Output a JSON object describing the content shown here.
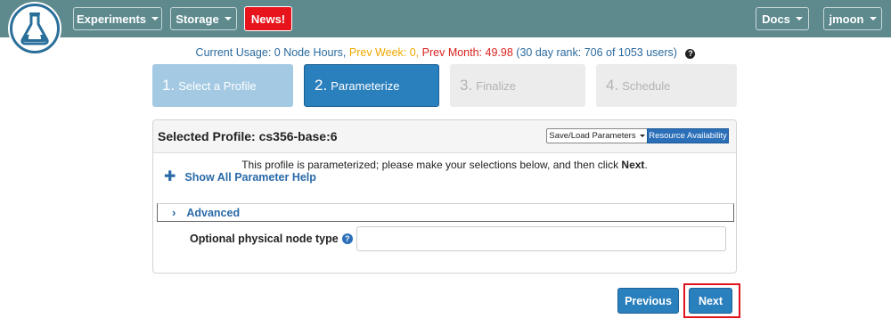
{
  "navbar": {
    "logo_icon": "flask-cloud-icon",
    "experiments_label": "Experiments",
    "storage_label": "Storage",
    "news_label": "News!",
    "docs_label": "Docs",
    "user_label": "jmoon"
  },
  "usage": {
    "current": "Current Usage: 0 Node Hours,",
    "prev_week": "Prev Week: 0,",
    "prev_month": "Prev Month: 49.98",
    "rank": "(30 day rank: 706 of 1053 users)",
    "help_icon": "question-circle-icon"
  },
  "steps": [
    {
      "num": "1.",
      "label": "Select a Profile",
      "state": "completed"
    },
    {
      "num": "2.",
      "label": "Parameterize",
      "state": "active"
    },
    {
      "num": "3.",
      "label": "Finalize",
      "state": "disabled"
    },
    {
      "num": "4.",
      "label": "Schedule",
      "state": "disabled"
    }
  ],
  "panel": {
    "title": "Selected Profile: cs356-base:6",
    "save_load_label": "Save/Load Parameters",
    "resource_label": "Resource Availability",
    "intro_text": "This profile is parameterized; please make your selections below, and then click ",
    "intro_bold": "Next",
    "intro_end": ".",
    "show_help_label": "Show All Parameter Help",
    "advanced_label": "Advanced",
    "node_type_label": "Optional physical node type",
    "node_type_value": ""
  },
  "buttons": {
    "previous_label": "Previous",
    "next_label": "Next"
  },
  "colors": {
    "navbar": "#5e8a8e",
    "news": "#e8141c",
    "primary": "#2a7fbd",
    "highlight": "#e0121c",
    "prev_week": "#f0a800",
    "prev_month": "#d9221e"
  }
}
